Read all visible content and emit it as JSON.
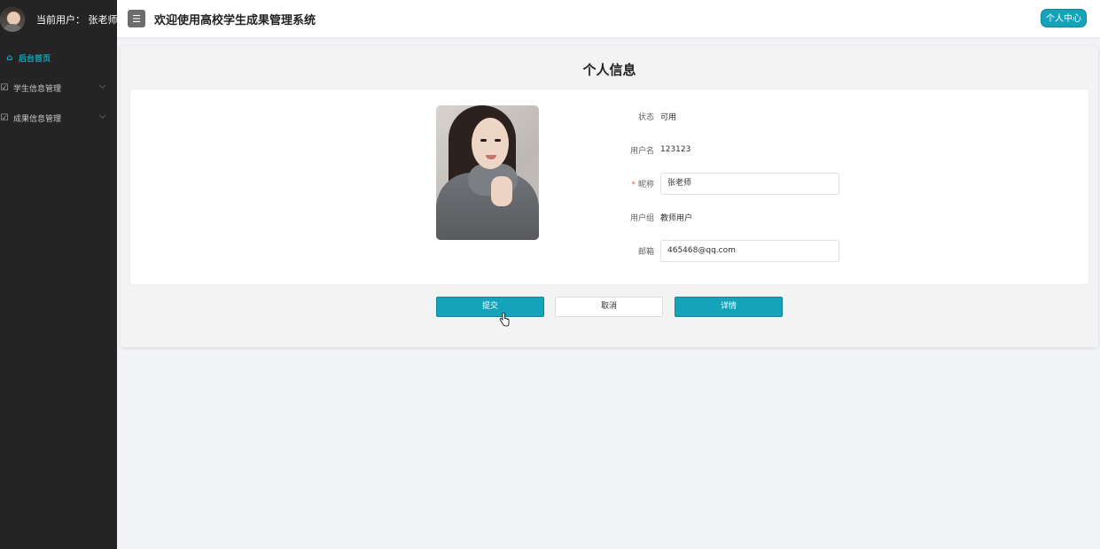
{
  "sidebar": {
    "current_user_label": "当前用户： 张老师",
    "items": [
      {
        "label": "后台首页",
        "icon": "home-icon"
      },
      {
        "label": "学生信息管理",
        "icon": "edit-icon"
      },
      {
        "label": "成果信息管理",
        "icon": "edit-icon"
      }
    ]
  },
  "header": {
    "title": "欢迎使用高校学生成果管理系统",
    "menu_icon": "hamburger-icon",
    "center_button": "个人中心"
  },
  "main": {
    "page_title": "个人信息",
    "fields": {
      "status_label": "状态",
      "status_value": "可用",
      "username_label": "用户名",
      "username_value": "123123",
      "nickname_required_mark": "*",
      "nickname_label": "昵称",
      "nickname_value": "张老师",
      "group_label": "用户组",
      "group_value": "教师用户",
      "email_label": "邮箱",
      "email_value": "465468@qq.com"
    },
    "buttons": {
      "submit": "提交",
      "cancel": "取消",
      "detail": "详情"
    }
  },
  "colors": {
    "accent": "#15a3b9",
    "sidebar_bg": "#242424",
    "page_bg": "#f3f4f7"
  }
}
